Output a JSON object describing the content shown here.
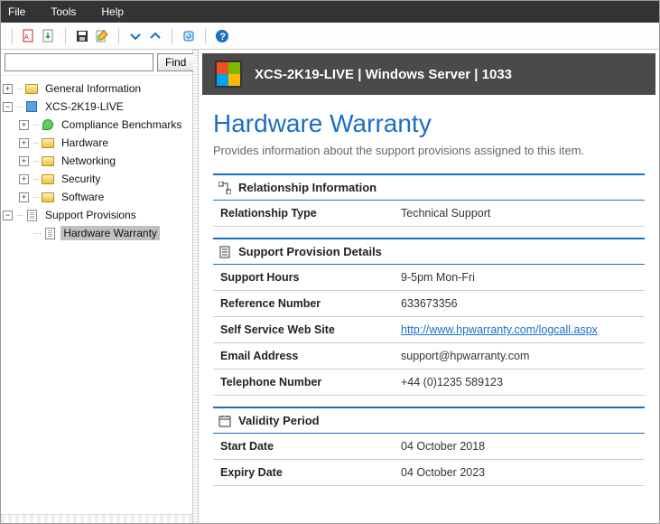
{
  "menu": {
    "file": "File",
    "tools": "Tools",
    "help": "Help"
  },
  "find": {
    "placeholder": "",
    "button": "Find"
  },
  "tree": {
    "general": "General Information",
    "host": "XCS-2K19-LIVE",
    "compliance": "Compliance Benchmarks",
    "hardware": "Hardware",
    "networking": "Networking",
    "security": "Security",
    "software": "Software",
    "support": "Support Provisions",
    "warranty": "Hardware Warranty"
  },
  "header": {
    "title": "XCS-2K19-LIVE | Windows Server | 1033"
  },
  "page": {
    "title": "Hardware Warranty",
    "subtitle": "Provides information about the support provisions assigned to this item."
  },
  "sections": {
    "relationship": {
      "heading": "Relationship Information",
      "rows": {
        "type_k": "Relationship Type",
        "type_v": "Technical Support"
      }
    },
    "details": {
      "heading": "Support Provision Details",
      "rows": {
        "hours_k": "Support Hours",
        "hours_v": "9-5pm Mon-Fri",
        "ref_k": "Reference Number",
        "ref_v": "633673356",
        "web_k": "Self Service Web Site",
        "web_v": "http://www.hpwarranty.com/logcall.aspx",
        "email_k": "Email Address",
        "email_v": "support@hpwarranty.com",
        "tel_k": "Telephone Number",
        "tel_v": "+44 (0)1235 589123"
      }
    },
    "validity": {
      "heading": "Validity Period",
      "rows": {
        "start_k": "Start Date",
        "start_v": "04 October 2018",
        "end_k": "Expiry Date",
        "end_v": "04 October 2023"
      }
    }
  }
}
